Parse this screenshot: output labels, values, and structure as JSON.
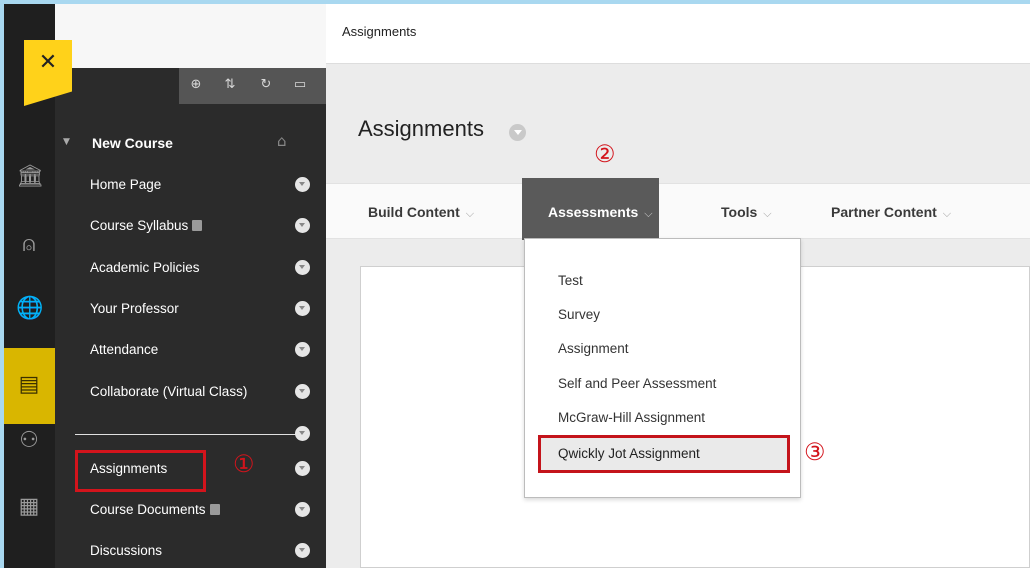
{
  "breadcrumb": "Assignments",
  "page_title": "Assignments",
  "course_menu": {
    "course_name": "New Course",
    "items": [
      {
        "label": "Home Page"
      },
      {
        "label": "Course Syllabus"
      },
      {
        "label": "Academic Policies"
      },
      {
        "label": "Your Professor"
      },
      {
        "label": "Attendance"
      },
      {
        "label": "Collaborate (Virtual Class)"
      },
      {
        "label": "Assignments"
      },
      {
        "label": "Course Documents"
      },
      {
        "label": "Discussions"
      }
    ]
  },
  "action_bar": {
    "items": [
      {
        "label": "Build Content"
      },
      {
        "label": "Assessments"
      },
      {
        "label": "Tools"
      },
      {
        "label": "Partner Content"
      }
    ]
  },
  "assessments_menu": {
    "items": [
      {
        "label": "Test"
      },
      {
        "label": "Survey"
      },
      {
        "label": "Assignment"
      },
      {
        "label": "Self and Peer Assessment"
      },
      {
        "label": "McGraw-Hill Assignment"
      },
      {
        "label": "Qwickly Jot Assignment"
      }
    ]
  },
  "annotations": {
    "step1": "①",
    "step2": "②",
    "step3": "③",
    "color": "#d3141c"
  },
  "colors": {
    "close_flag": "#ffd21a",
    "active_rail": "#d9b600",
    "menu_bg": "#2b2b2b",
    "active_tab": "#5a5a5a"
  }
}
